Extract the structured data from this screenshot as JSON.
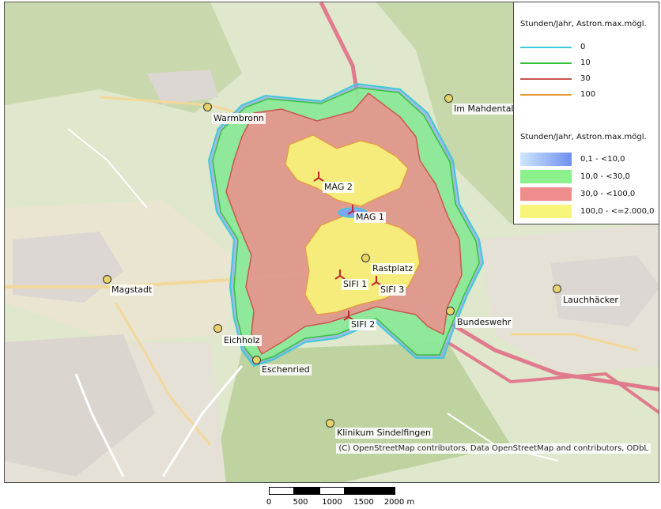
{
  "map": {
    "places": [
      {
        "key": "warmbronn",
        "name": "Warmbronn"
      },
      {
        "key": "im_mahdental",
        "name": "Im Mahdental"
      },
      {
        "key": "magstadt",
        "name": "Magstadt"
      },
      {
        "key": "eichholz",
        "name": "Eichholz"
      },
      {
        "key": "eschenried",
        "name": "Eschenried"
      },
      {
        "key": "rastplatz",
        "name": "Rastplatz"
      },
      {
        "key": "bundeswehr",
        "name": "Bundeswehr"
      },
      {
        "key": "lauchhaecker",
        "name": "Lauchhäcker"
      },
      {
        "key": "klinikum",
        "name": "Klinikum Sindelfingen"
      }
    ],
    "turbines": [
      {
        "key": "mag2",
        "name": "MAG 2"
      },
      {
        "key": "mag1",
        "name": "MAG 1"
      },
      {
        "key": "sifi1",
        "name": "SIFI 1"
      },
      {
        "key": "sifi3",
        "name": "SIFI 3"
      },
      {
        "key": "sifi2",
        "name": "SIFI 2"
      }
    ],
    "copyright": "(C) OpenStreetMap contributors, Data OpenStreetMap and contributors, ODbL"
  },
  "legend": {
    "title1": "Stunden/Jahr, Astron.max.mögl.",
    "lines": [
      {
        "label": "0",
        "color": "#3ec9d6"
      },
      {
        "label": "10",
        "color": "#35c23a"
      },
      {
        "label": "30",
        "color": "#c9574e"
      },
      {
        "label": "100",
        "color": "#e59a38"
      }
    ],
    "title2": "Stunden/Jahr, Astron.max.mögl.",
    "fills": [
      {
        "label": "0,1 - <10,0",
        "color": "#6f8ff0"
      },
      {
        "label": "10,0 - <30,0",
        "color": "#8cf08c"
      },
      {
        "label": "30,0 - <100,0",
        "color": "#ef8d8d"
      },
      {
        "label": "100,0 - <=2.000,0",
        "color": "#f7f57a"
      }
    ]
  },
  "scalebar": {
    "ticks": [
      "0",
      "500",
      "1000",
      "1500",
      "2000 m"
    ]
  }
}
